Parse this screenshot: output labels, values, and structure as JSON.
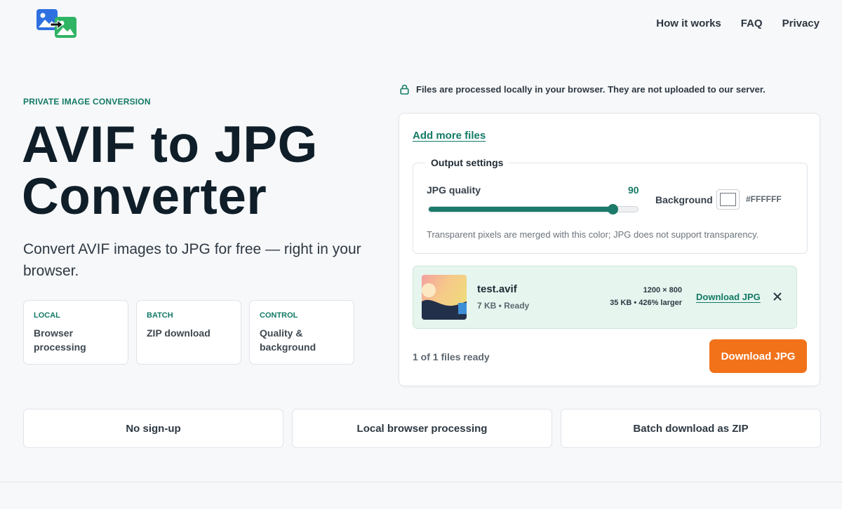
{
  "header": {
    "logo_icon": "image-convert-icon",
    "nav": [
      {
        "label": "How it works"
      },
      {
        "label": "FAQ"
      },
      {
        "label": "Privacy"
      }
    ]
  },
  "hero": {
    "eyebrow": "PRIVATE IMAGE CONVERSION",
    "title": "AVIF to JPG Converter",
    "subtitle": "Convert AVIF images to JPG for free — right in your browser.",
    "features": [
      {
        "tag": "LOCAL",
        "text": "Browser processing"
      },
      {
        "tag": "BATCH",
        "text": "ZIP download"
      },
      {
        "tag": "CONTROL",
        "text": "Quality & background"
      }
    ]
  },
  "converter": {
    "privacy_note": "Files are processed locally in your browser. They are not uploaded to our server.",
    "add_more_label": "Add more files",
    "settings": {
      "legend": "Output settings",
      "quality_label": "JPG quality",
      "quality_value": "90",
      "quality_fraction": 0.88,
      "background_label": "Background",
      "background_hex": "#FFFFFF",
      "note": "Transparent pixels are merged with this color; JPG does not support transparency."
    },
    "file": {
      "name": "test.avif",
      "meta": "7 KB • Ready",
      "dimensions": "1200 × 800",
      "output": "35 KB • 426% larger",
      "download_label": "Download JPG"
    },
    "status": "1 of 1 files ready",
    "download_button": "Download JPG"
  },
  "benefits": [
    {
      "label": "No sign-up"
    },
    {
      "label": "Local browser processing"
    },
    {
      "label": "Batch download as ZIP"
    }
  ],
  "colors": {
    "accent": "#137A66",
    "cta": "#F2721A",
    "file_row_bg": "#E6F5EE",
    "page_bg": "#F7F8FA"
  }
}
